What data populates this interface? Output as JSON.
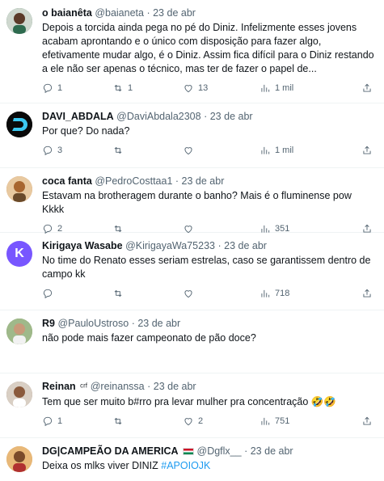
{
  "tweets": [
    {
      "name": "o baianêta",
      "handle": "@baianeta",
      "date": "23 de abr",
      "text": "Depois a torcida ainda pega no pé do Diniz. Infelizmente esses jovens acabam aprontando e o único com disposição para fazer algo, efetivamente mudar algo, é o Diniz.  Assim fica difícil para o Diniz restando a ele não ser apenas o técnico, mas ter de fazer o papel de...",
      "replies": "1",
      "retweets": "1",
      "likes": "13",
      "views": "1 mil",
      "avatar_color": "#2e6b4f"
    },
    {
      "name": "DAVI_ABDALA",
      "handle": "@DaviAbdala2308",
      "date": "23 de abr",
      "text": "Por que? Do nada?",
      "replies": "3",
      "retweets": "",
      "likes": "",
      "views": "1 mil",
      "avatar_color": "#0a0a0a"
    },
    {
      "name": "coca fanta",
      "handle": "@PedroCosttaa1",
      "date": "23 de abr",
      "text": "Estavam na brotheragem durante o banho? Mais é o fluminense pow Kkkk",
      "replies": "2",
      "retweets": "",
      "likes": "",
      "views": "351",
      "avatar_color": "#c47a3a"
    },
    {
      "name": "Kirigaya Wasabe",
      "handle": "@KirigayaWa75233",
      "date": "23 de abr",
      "text": "No time do Renato esses seriam estrelas, caso se garantissem dentro de campo kk",
      "replies": "",
      "retweets": "",
      "likes": "",
      "views": "718",
      "avatar_color": "#7856ff",
      "avatar_letter": "K"
    },
    {
      "name": "R9",
      "handle": "@PauloUstroso",
      "date": "23 de abr",
      "text": "não pode mais fazer campeonato de pão doce?",
      "replies": "",
      "retweets": "",
      "likes": "",
      "views": "",
      "avatar_color": "#6b8e4e"
    },
    {
      "name": "Reinan",
      "name_badge": "ᶜʳᶠ",
      "handle": "@reinanssa",
      "date": "23 de abr",
      "text": "Tem que ser muito b#rro pra levar mulher pra concentração 🤣🤣",
      "replies": "1",
      "retweets": "",
      "likes": "2",
      "views": "751",
      "avatar_color": "#8a6a55"
    },
    {
      "name": "DG|CAMPEÃO DA AMERICA",
      "handle": "@Dgflx__",
      "date": "23 de abr",
      "text": "Deixa os mlks viver DINIZ",
      "hashtag": "#APOIOJK",
      "avatar_color": "#d9a15c"
    }
  ],
  "icons": {
    "reply": "reply-icon",
    "retweet": "retweet-icon",
    "like": "heart-icon",
    "views": "views-icon",
    "share": "share-icon"
  }
}
